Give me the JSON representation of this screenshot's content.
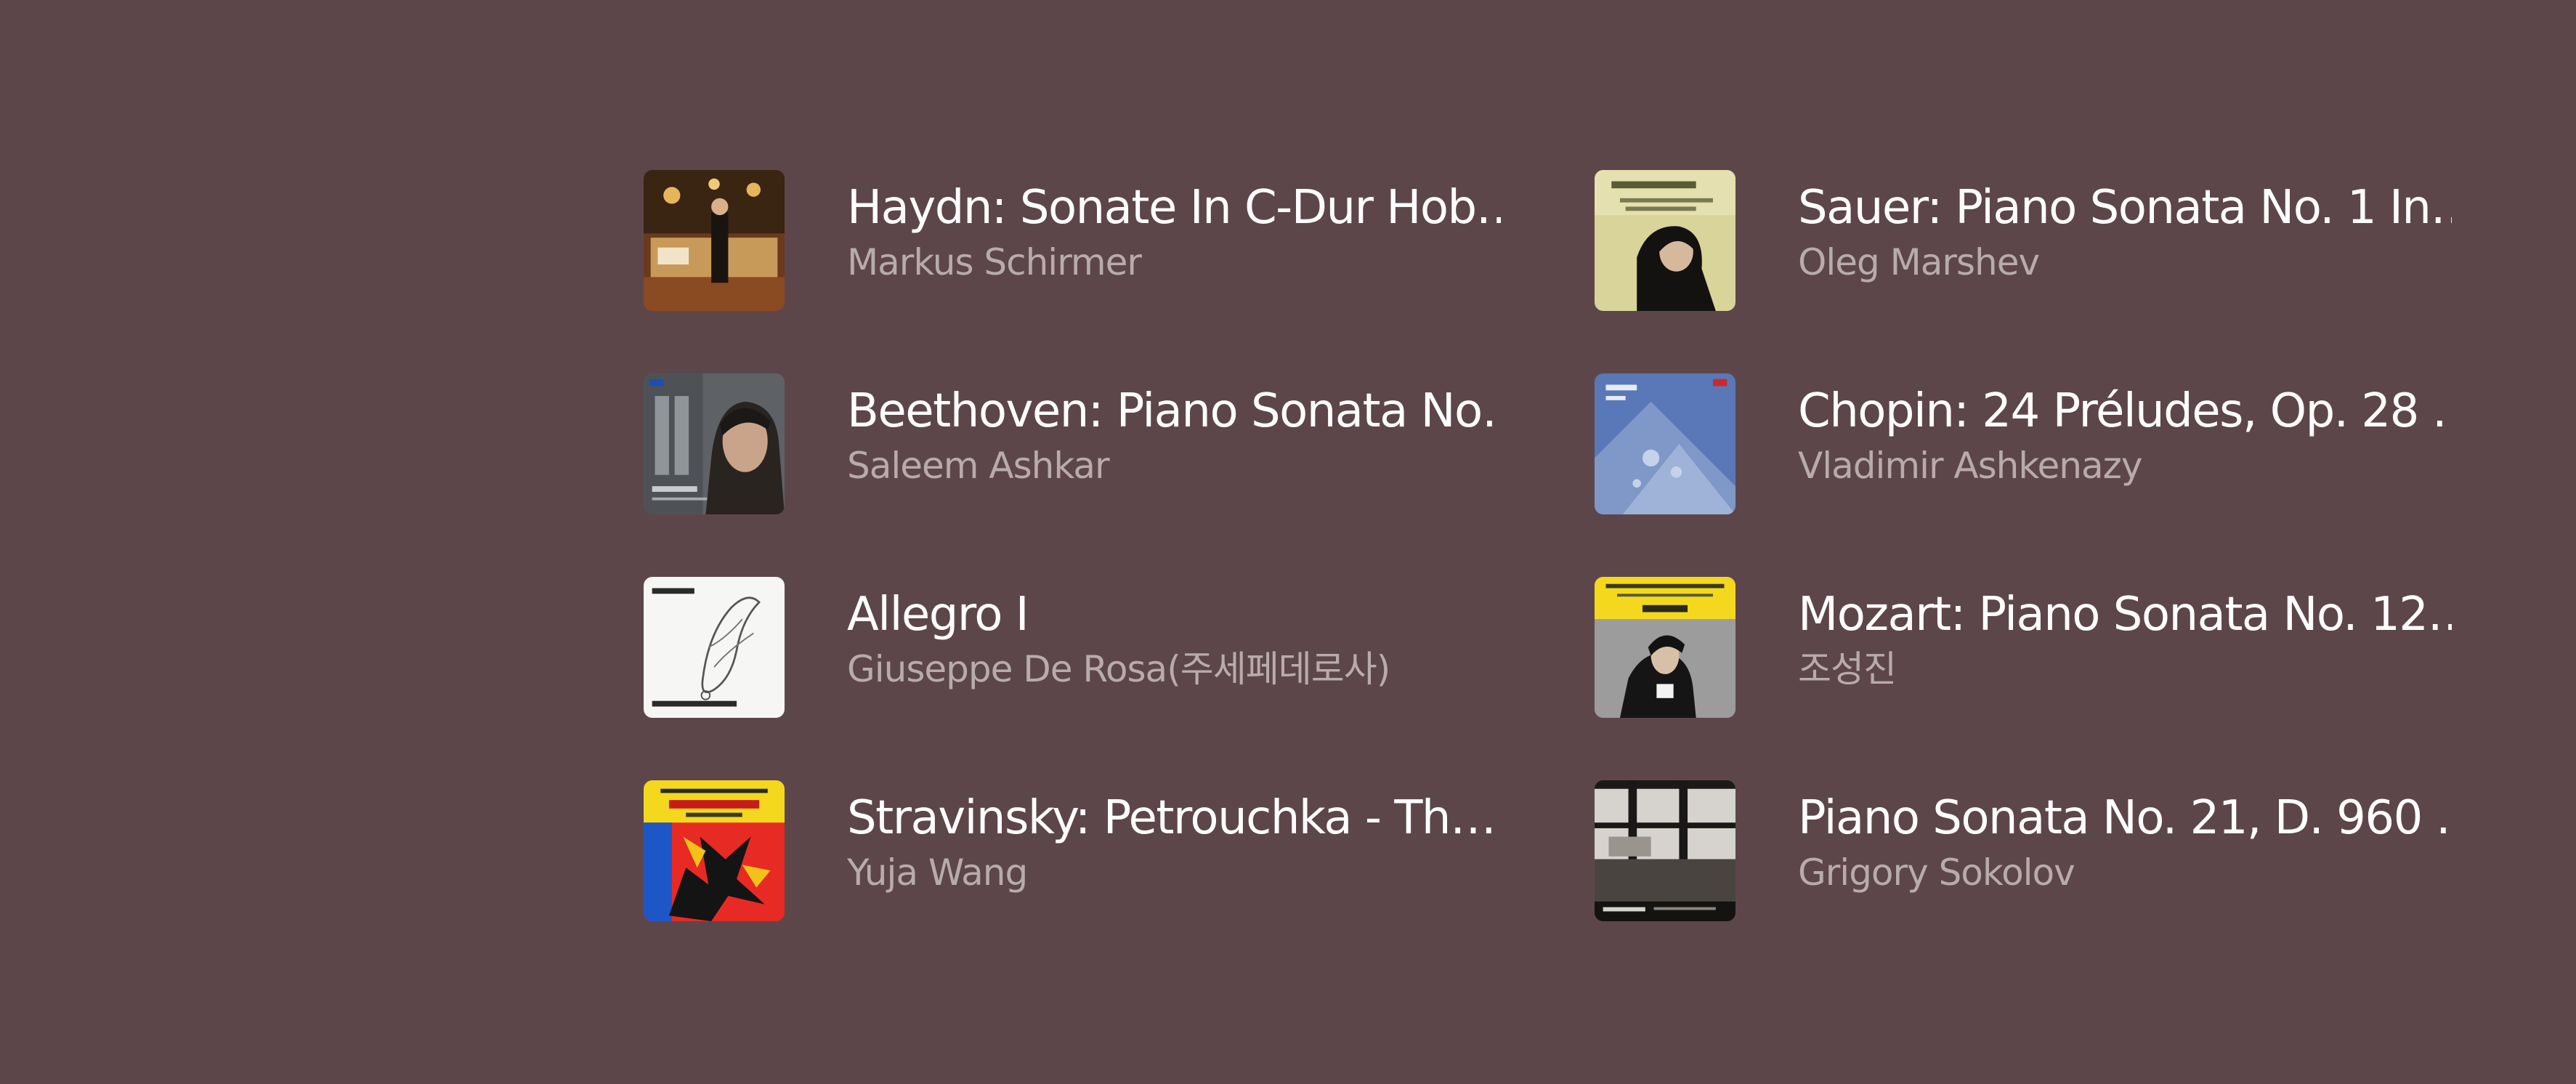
{
  "theme": {
    "background": "#5d464a",
    "title_color": "#ffffff",
    "artist_color": "#b8abad"
  },
  "tracks": [
    {
      "title": "Haydn: Sonate In C-Dur Hob…",
      "artist": "Markus Schirmer",
      "cover_icon": "album-cover-haydn"
    },
    {
      "title": "Sauer: Piano Sonata No. 1 In…",
      "artist": "Oleg Marshev",
      "cover_icon": "album-cover-sauer"
    },
    {
      "title": "Beethoven: Piano Sonata No…",
      "artist": "Saleem Ashkar",
      "cover_icon": "album-cover-beethoven"
    },
    {
      "title": "Chopin: 24 Préludes, Op. 28 …",
      "artist": "Vladimir Ashkenazy",
      "cover_icon": "album-cover-chopin"
    },
    {
      "title": "Allegro I",
      "artist": "Giuseppe De Rosa(주세페데로사)",
      "cover_icon": "album-cover-allegro"
    },
    {
      "title": "Mozart: Piano Sonata No. 12…",
      "artist": "조성진",
      "cover_icon": "album-cover-mozart"
    },
    {
      "title": "Stravinsky: Petrouchka - Th…",
      "artist": "Yuja Wang",
      "cover_icon": "album-cover-stravinsky"
    },
    {
      "title": "Piano Sonata No. 21, D. 960 …",
      "artist": "Grigory Sokolov",
      "cover_icon": "album-cover-schubert"
    }
  ]
}
